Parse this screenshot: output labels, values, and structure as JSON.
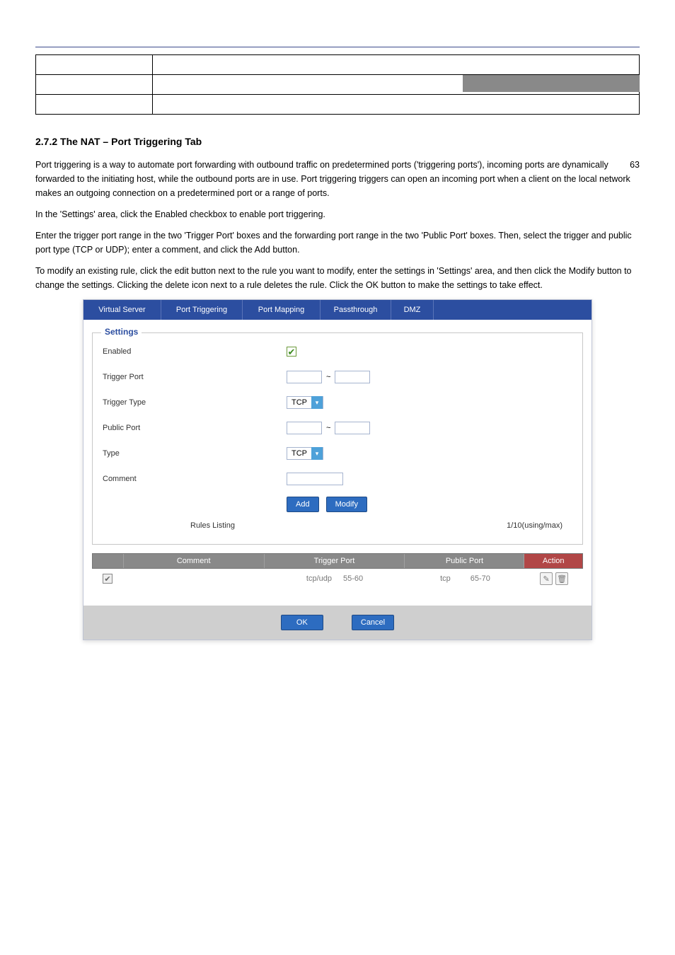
{
  "header": {
    "banner": ""
  },
  "param_table": {
    "rows": [
      {
        "label": "",
        "desc": ""
      },
      {
        "label": "",
        "desc": ""
      },
      {
        "label": "",
        "desc": ""
      }
    ]
  },
  "section": {
    "number_title": "2.7.2  The NAT – Port Triggering Tab",
    "para1_part1": "Port triggering is a way to automate port forwarding with outbound traffic on predetermined ports ('triggering ports'), incoming ports are dynamically forwarded to the initiating host, while the outbound ports are in use. Port triggering triggers can open an incoming port when a client on the local network makes an outgoing connection on a predetermined port or a range of ports.",
    "page_mark": "63",
    "para2": "In the 'Settings' area, click the Enabled checkbox to enable port triggering.",
    "para3": "Enter the trigger port range in the two 'Trigger Port' boxes and the forwarding port range in the two 'Public Port' boxes. Then, select the trigger and public port type (TCP or UDP); enter a comment, and click the Add button.",
    "para4": "To modify an existing rule, click the edit button next to the rule you want to modify, enter the settings in 'Settings' area, and then click the Modify button to change the settings. Clicking the delete icon next to a rule deletes the rule. Click the OK button to make the settings to take effect."
  },
  "ui": {
    "tabs": [
      "Virtual Server",
      "Port Triggering",
      "Port Mapping",
      "Passthrough",
      "DMZ"
    ],
    "fieldset_legend": "Settings",
    "rows": {
      "enabled_label": "Enabled",
      "trigger_port_label": "Trigger Port",
      "trigger_type_label": "Trigger Type",
      "public_port_label": "Public Port",
      "type_label": "Type",
      "comment_label": "Comment",
      "trigger_type_value": "TCP",
      "type_value": "TCP",
      "tilde": "~"
    },
    "buttons": {
      "add": "Add",
      "modify": "Modify",
      "ok": "OK",
      "cancel": "Cancel"
    },
    "rules_listing_label": "Rules Listing",
    "rules_count": "1/10(using/max)",
    "columns": {
      "comment": "Comment",
      "trigger_port": "Trigger Port",
      "public_port": "Public Port",
      "action": "Action"
    },
    "row1": {
      "comment": "",
      "trigger_proto": "tcp/udp",
      "trigger_range": "55-60",
      "public_proto": "tcp",
      "public_range": "65-70"
    },
    "icons": {
      "edit": "✎",
      "delete": "🗑",
      "check": "✔",
      "chevron": "▾"
    }
  }
}
